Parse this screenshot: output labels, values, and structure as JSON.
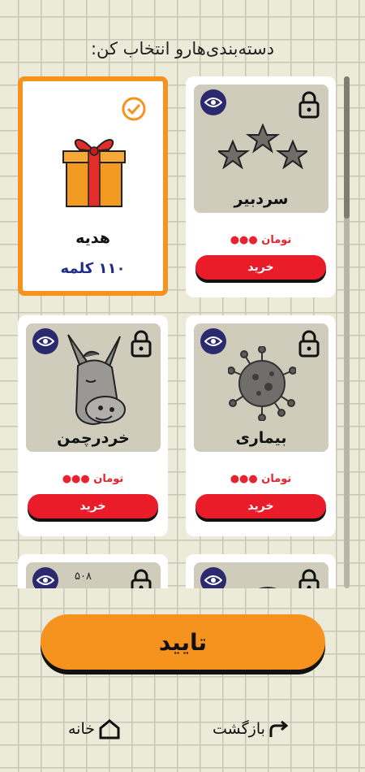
{
  "header": {
    "title": "دسته‌بندی‌هارو انتخاب کن:"
  },
  "categories": [
    {
      "name": "سردبیر",
      "price": "تومان",
      "price_dots": "●●●",
      "buy": "خرید",
      "locked": true
    },
    {
      "name": "هدیه",
      "count": "۱۱۰ کلمه",
      "selected": true
    },
    {
      "name": "بیماری",
      "price": "تومان",
      "price_dots": "●●●",
      "buy": "خرید",
      "locked": true
    },
    {
      "name": "خردرچمن",
      "price": "تومان",
      "price_dots": "●●●",
      "buy": "خرید",
      "locked": true
    },
    {
      "partial_label": "۵۰۸"
    }
  ],
  "actions": {
    "confirm": "تایید"
  },
  "bottom_nav": {
    "back": "بازگشت",
    "home": "خانه"
  },
  "colors": {
    "accent": "#f6931e",
    "buy": "#ea1c2a",
    "eye": "#2b2a6e",
    "count": "#1f2d8a"
  }
}
